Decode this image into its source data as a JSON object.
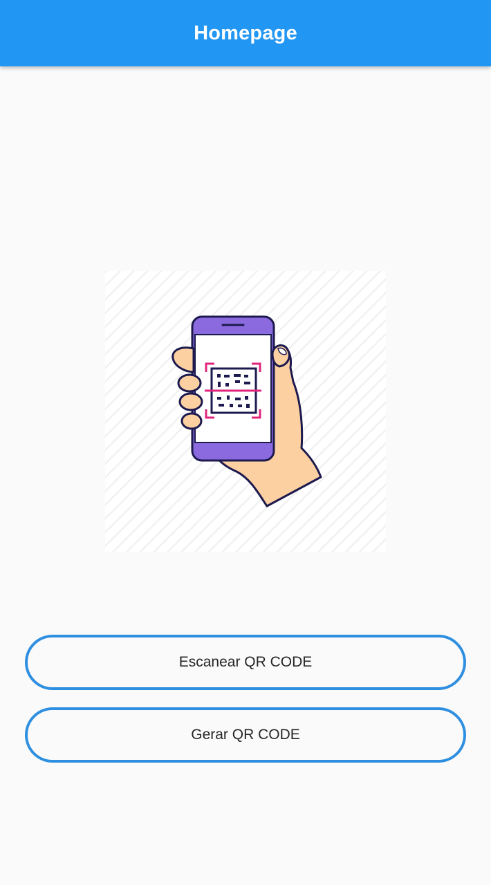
{
  "app_bar": {
    "title": "Homepage",
    "color": "#2196f3"
  },
  "illustration": {
    "icon": "phone-scanning-qr-illustration",
    "colors": {
      "phone_frame": "#8b6ae0",
      "outline": "#1c1a4e",
      "skin": "#fdd0a2",
      "scan_marks": "#e0247c"
    }
  },
  "buttons": {
    "scan_label": "Escanear QR CODE",
    "generate_label": "Gerar QR CODE",
    "border_color": "#2e8fe0"
  }
}
